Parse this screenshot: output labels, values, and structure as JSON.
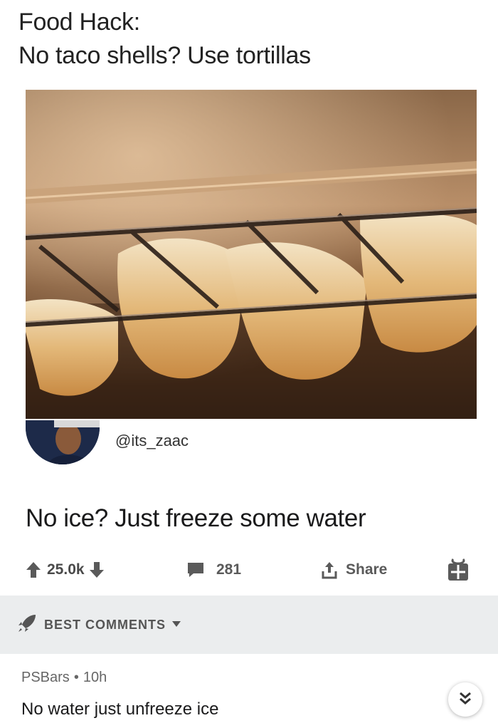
{
  "post": {
    "title_line1": "Food Hack:",
    "title_line2": "No taco shells? Use tortillas",
    "image_icon": "tortillas-hanging-on-oven-rack",
    "author_handle": "@its_zaac",
    "caption": "No ice? Just freeze some water"
  },
  "actions": {
    "vote_count": "25.0k",
    "comment_count": "281",
    "share_label": "Share"
  },
  "sort": {
    "label": "BEST COMMENTS"
  },
  "comment": {
    "author": "PSBars",
    "separator": "•",
    "age": "10h",
    "body": "No water just unfreeze ice"
  },
  "colors": {
    "icon_gray": "#5a5a5a",
    "sort_bar_bg": "#ebedee"
  }
}
